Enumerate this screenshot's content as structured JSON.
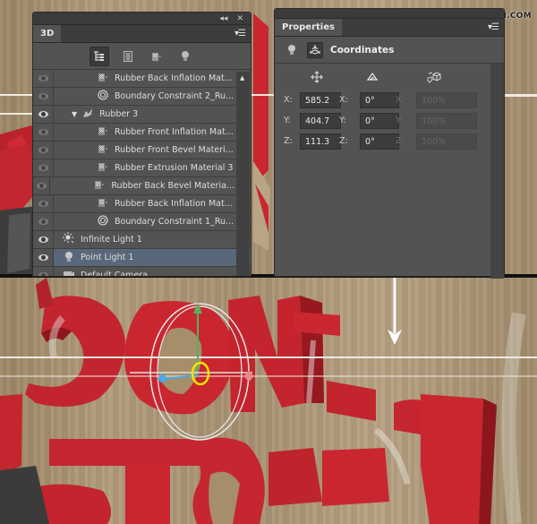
{
  "watermark": "思缘设计论坛  WWW.MISSYUAN.COM",
  "panel_3d": {
    "tab_label": "3D",
    "collapse_icon": "double-chevron-left-icon",
    "close_icon": "close-icon",
    "menu_icon": "panel-menu-icon",
    "filters": [
      {
        "name": "whole-scene-filter",
        "icon": "scene-tree-icon",
        "active": true
      },
      {
        "name": "meshes-filter",
        "icon": "mesh-icon",
        "active": false
      },
      {
        "name": "materials-filter",
        "icon": "material-icon",
        "active": false
      },
      {
        "name": "lights-filter",
        "icon": "light-bulb-icon",
        "active": false
      }
    ],
    "layers": [
      {
        "label": "Rubber Back Inflation Mat...",
        "icon": "material-icon",
        "indent": 2,
        "visible": false,
        "selected": false
      },
      {
        "label": "Boundary Constraint 2_Ru...",
        "icon": "constraint-icon",
        "indent": 2,
        "visible": false,
        "selected": false
      },
      {
        "label": "Rubber 3",
        "icon": "mesh-icon",
        "indent": 1,
        "visible": true,
        "selected": false,
        "expanded": true
      },
      {
        "label": "Rubber Front Inflation Mat...",
        "icon": "material-icon",
        "indent": 2,
        "visible": false,
        "selected": false
      },
      {
        "label": "Rubber Front Bevel Materi...",
        "icon": "material-icon",
        "indent": 2,
        "visible": false,
        "selected": false
      },
      {
        "label": "Rubber Extrusion Material 3",
        "icon": "material-icon",
        "indent": 2,
        "visible": false,
        "selected": false
      },
      {
        "label": "Rubber Back Bevel Materia...",
        "icon": "material-icon",
        "indent": 2,
        "visible": false,
        "selected": false
      },
      {
        "label": "Rubber Back Inflation Mat...",
        "icon": "material-icon",
        "indent": 2,
        "visible": false,
        "selected": false
      },
      {
        "label": "Boundary Constraint 1_Ru...",
        "icon": "constraint-icon",
        "indent": 2,
        "visible": false,
        "selected": false
      },
      {
        "label": "Infinite Light 1",
        "icon": "infinite-light-icon",
        "indent": 0,
        "visible": true,
        "selected": false
      },
      {
        "label": "Point Light 1",
        "icon": "point-light-icon",
        "indent": 0,
        "visible": true,
        "selected": true
      },
      {
        "label": "Default Camera",
        "icon": "camera-icon",
        "indent": 0,
        "visible": false,
        "selected": false
      }
    ]
  },
  "panel_properties": {
    "tab_label": "Properties",
    "menu_icon": "panel-menu-icon",
    "mode_icons": [
      "light-bulb-icon",
      "coordinates-icon"
    ],
    "title": "Coordinates",
    "columns": [
      {
        "icon": "move-icon",
        "fields": [
          {
            "axis": "X:",
            "value": "585.2"
          },
          {
            "axis": "Y:",
            "value": "404.7"
          },
          {
            "axis": "Z:",
            "value": "111.3"
          }
        ]
      },
      {
        "icon": "rotate-icon",
        "fields": [
          {
            "axis": "X:",
            "value": "0°"
          },
          {
            "axis": "Y:",
            "value": "0°"
          },
          {
            "axis": "Z:",
            "value": "0°"
          }
        ]
      },
      {
        "icon": "scale-icon",
        "disabled": true,
        "fields": [
          {
            "axis": "X:",
            "value": "100%"
          },
          {
            "axis": "Y:",
            "value": "100%"
          },
          {
            "axis": "Z:",
            "value": "100%"
          }
        ]
      }
    ]
  },
  "scene": {
    "description": "3D red rubber letters on wood background with point light gizmo",
    "gizmo_colors": {
      "y_axis": "#4caf50",
      "x_axis": "#4aa8e0",
      "z_axis": "#e88a8a",
      "center": "#f2e600",
      "rings": "#e8e8e8"
    },
    "arrow_color": "#ffffff"
  }
}
